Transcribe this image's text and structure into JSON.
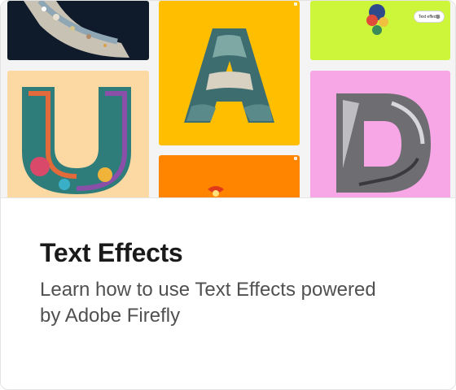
{
  "card": {
    "title": "Text Effects",
    "description": "Learn how to use Text Effects powered by Adobe Firefly"
  },
  "preview": {
    "chip_label": "Text effects",
    "chip_icon": "gear-icon",
    "colors": {
      "navy": "#0f1a2b",
      "peach": "#fcd9a3",
      "yellow": "#ffbe00",
      "orange": "#ff8500",
      "lime": "#cdf53a",
      "pink": "#f7a6e6"
    }
  }
}
